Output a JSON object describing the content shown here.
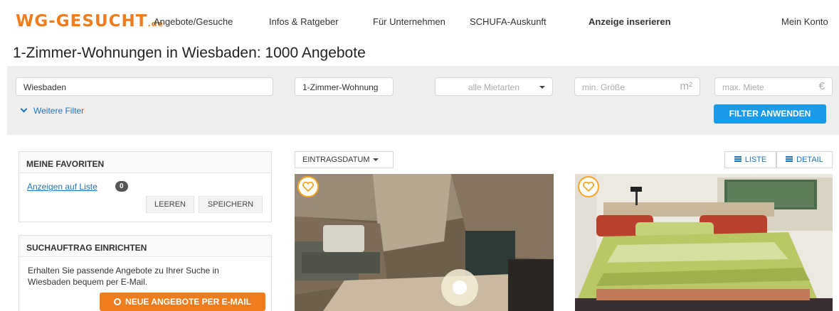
{
  "header": {
    "logo_main": "WG-GESUCHT",
    "logo_suffix": ".de",
    "nav": [
      "Angebote/Gesuche",
      "Infos & Ratgeber",
      "Für Unternehmen",
      "SCHUFA-Auskunft",
      "Anzeige inserieren",
      "Mein Konto"
    ]
  },
  "page_title": "1-Zimmer-Wohnungen in Wiesbaden: 1000 Angebote",
  "filters": {
    "city": "Wiesbaden",
    "category": "1-Zimmer-Wohnung",
    "rent_type_placeholder": "alle Mietarten",
    "min_size_placeholder": "min. Größe",
    "size_unit": "m²",
    "max_rent_placeholder": "max. Miete",
    "currency": "€",
    "more_filters": "Weitere Filter",
    "apply": "FILTER ANWENDEN"
  },
  "favorites": {
    "title": "MEINE FAVORITEN",
    "link": "Anzeigen auf Liste",
    "count": "0",
    "clear": "LEEREN",
    "save": "SPEICHERN"
  },
  "search_order": {
    "title": "SUCHAUFTRAG EINRICHTEN",
    "text": "Erhalten Sie passende Angebote zu Ihrer Suche in Wiesbaden bequem per E-Mail.",
    "button": "NEUE ANGEBOTE PER E-MAIL"
  },
  "results": {
    "sort": "EINTRAGSDATUM",
    "view_list": "LISTE",
    "view_detail": "DETAIL"
  },
  "colors": {
    "brand": "#f07d1d",
    "link": "#1e73be",
    "apply": "#1a9bea",
    "heart": "#f5a623"
  }
}
